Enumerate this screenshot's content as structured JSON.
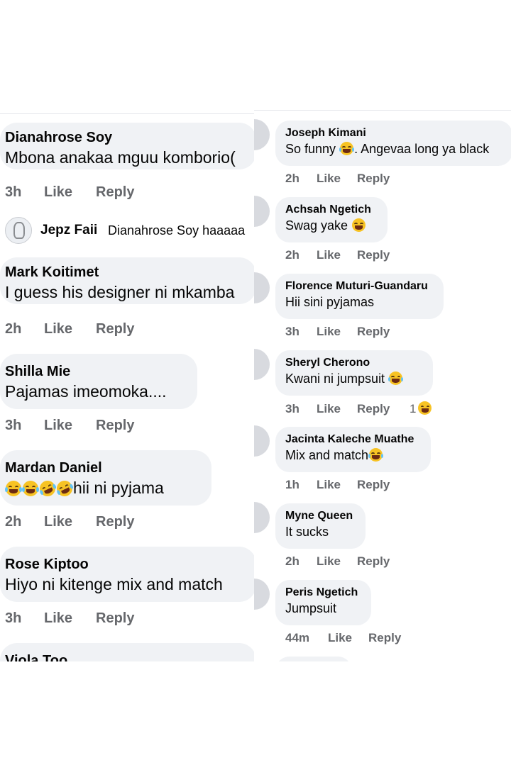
{
  "left_comments": [
    {
      "name": "Dianahrose Soy",
      "text": "Mbona anakaa mguu komborio(",
      "time": "3h",
      "like": "Like",
      "reply": "Reply"
    },
    {
      "name": "Mark Koitimet",
      "text": "I guess his designer ni mkamba",
      "time": "2h",
      "like": "Like",
      "reply": "Reply"
    },
    {
      "name": "Shilla Mie",
      "text": "Pajamas imeomoka....",
      "time": "3h",
      "like": "Like",
      "reply": "Reply"
    },
    {
      "name": "Mardan Daniel",
      "text": "hii ni pyjama",
      "time": "2h",
      "like": "Like",
      "reply": "Reply"
    },
    {
      "name": "Rose Kiptoo",
      "text": "Hiyo ni kitenge mix and match",
      "time": "3h",
      "like": "Like",
      "reply": "Reply"
    },
    {
      "name": "Viola Too"
    }
  ],
  "left_reply": {
    "name": "Jepz Faii",
    "text": "Dianahrose Soy haaaaa"
  },
  "right_comments": [
    {
      "name": "Joseph Kimani",
      "text_before": "So funny ",
      "text_after": ". Angevaa long ya black",
      "time": "2h",
      "like": "Like",
      "reply": "Reply"
    },
    {
      "name": "Achsah Ngetich",
      "text_before": "Swag yake ",
      "time": "2h",
      "like": "Like",
      "reply": "Reply"
    },
    {
      "name": "Florence Muturi-Guandaru",
      "text_before": "Hii sini pyjamas",
      "time": "3h",
      "like": "Like",
      "reply": "Reply"
    },
    {
      "name": "Sheryl Cherono",
      "text_before": "Kwani ni jumpsuit ",
      "time": "3h",
      "like": "Like",
      "reply": "Reply",
      "reaction_count": "1"
    },
    {
      "name": "Jacinta Kaleche Muathe",
      "text_before": "Mix and match",
      "time": "1h",
      "like": "Like",
      "reply": "Reply"
    },
    {
      "name": "Myne Queen",
      "text_before": "It sucks",
      "time": "2h",
      "like": "Like",
      "reply": "Reply"
    },
    {
      "name": "Peris Ngetich",
      "text_before": "Jumpsuit",
      "time": "44m",
      "like": "Like",
      "reply": "Reply"
    }
  ],
  "colors": {
    "bubble": "#f0f2f5",
    "meta_text": "#65676b",
    "name_text": "#050505",
    "emoji": "#f7c324"
  }
}
